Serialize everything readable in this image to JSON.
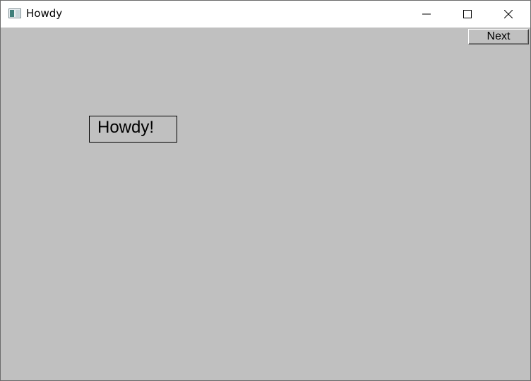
{
  "window": {
    "title": "Howdy",
    "controls": [
      "minimize-icon",
      "maximize-icon",
      "close-icon"
    ]
  },
  "toolbar": {
    "next_label": "Next"
  },
  "main": {
    "greeting": "Howdy!"
  },
  "colors": {
    "client_background": "#c0c0c0",
    "titlebar_background": "#ffffff",
    "text": "#000000"
  }
}
